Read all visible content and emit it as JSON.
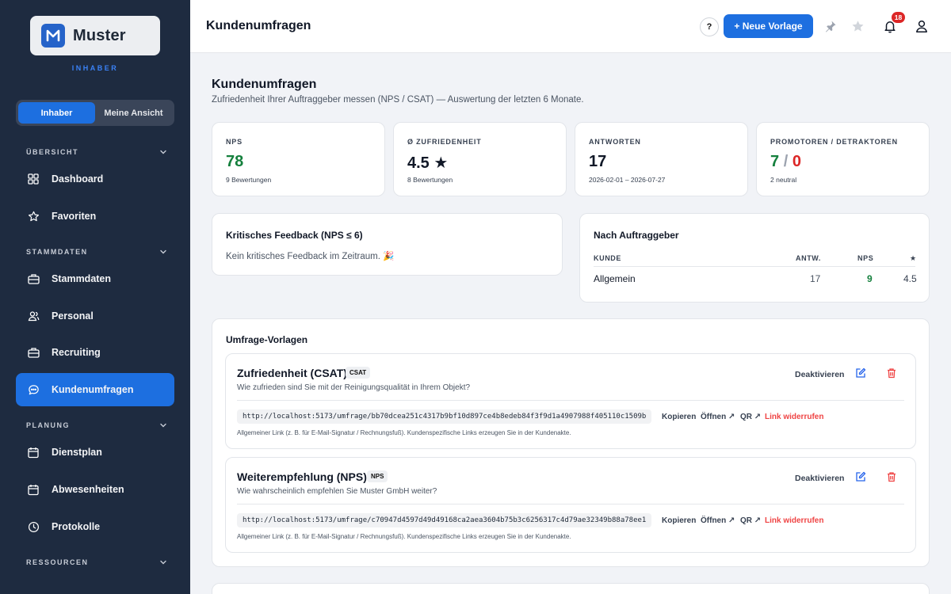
{
  "brand": {
    "name": "Muster",
    "role": "INHABER"
  },
  "switcher": {
    "owner": "Inhaber",
    "mine": "Meine Ansicht"
  },
  "nav": {
    "sections": {
      "overview": "ÜBERSICHT",
      "master": "STAMMDATEN",
      "planning": "PLANUNG",
      "resources": "RESSOURCEN"
    },
    "items": {
      "dashboard": "Dashboard",
      "favorites": "Favoriten",
      "masterdata": "Stammdaten",
      "staff": "Personal",
      "recruiting": "Recruiting",
      "surveys": "Kundenumfragen",
      "roster": "Dienstplan",
      "absences": "Abwesenheiten",
      "logs": "Protokolle"
    }
  },
  "topbar": {
    "title": "Kundenumfragen",
    "help": "?",
    "new_template": "+ Neue Vorlage",
    "notifications": "18"
  },
  "page": {
    "title": "Kundenumfragen",
    "subtitle": "Zufriedenheit Ihrer Auftraggeber messen (NPS / CSAT) — Auswertung der letzten 6 Monate."
  },
  "stats": {
    "nps": {
      "label": "NPS",
      "value": "78",
      "note": "9 Bewertungen"
    },
    "csat": {
      "label": "Ø ZUFRIEDENHEIT",
      "value": "4.5 ★",
      "note": "8 Bewertungen"
    },
    "answers": {
      "label": "ANTWORTEN",
      "value": "17",
      "note": "2026-02-01 – 2026-07-27"
    },
    "promoters": {
      "label": "PROMOTOREN / DETRAKTOREN",
      "promoters": "7",
      "sep": "/",
      "detractors": "0",
      "note": "2 neutral"
    }
  },
  "critical": {
    "title": "Kritisches Feedback (NPS ≤ 6)",
    "empty": "Kein kritisches Feedback im Zeitraum. 🎉"
  },
  "by_client": {
    "title": "Nach Auftraggeber",
    "headers": {
      "client": "KUNDE",
      "answers": "ANTW.",
      "nps": "NPS",
      "star": "★"
    },
    "rows": [
      {
        "client": "Allgemein",
        "answers": "17",
        "nps": "9",
        "rating": "4.5"
      }
    ]
  },
  "templates": {
    "title": "Umfrage-Vorlagen",
    "actions": {
      "deactivate": "Deaktivieren",
      "copy": "Kopieren",
      "open": "Öffnen ↗",
      "qr": "QR ↗",
      "revoke": "Link widerrufen"
    },
    "hint": "Allgemeiner Link (z. B. für E-Mail-Signatur / Rechnungsfuß). Kundenspezifische Links erzeugen Sie in der Kundenakte.",
    "items": [
      {
        "name": "Zufriedenheit (CSAT)",
        "badge": "CSAT",
        "question": "Wie zufrieden sind Sie mit der Reinigungsqualität in Ihrem Objekt?",
        "url": "http://localhost:5173/umfrage/bb70dcea251c4317b9bf10d897ce4b8edeb84f3f9d1a4907988f405110c1509b"
      },
      {
        "name": "Weiterempfehlung (NPS)",
        "badge": "NPS",
        "question": "Wie wahrscheinlich empfehlen Sie Muster GmbH weiter?",
        "url": "http://localhost:5173/umfrage/c70947d4597d49d49168ca2aea3604b75b3c6256317c4d79ae32349b88a78ee1"
      }
    ]
  },
  "colors": {
    "accent": "#1d6fe0",
    "sidebar": "#1e2b40",
    "success": "#15803d",
    "danger": "#dc2626"
  }
}
